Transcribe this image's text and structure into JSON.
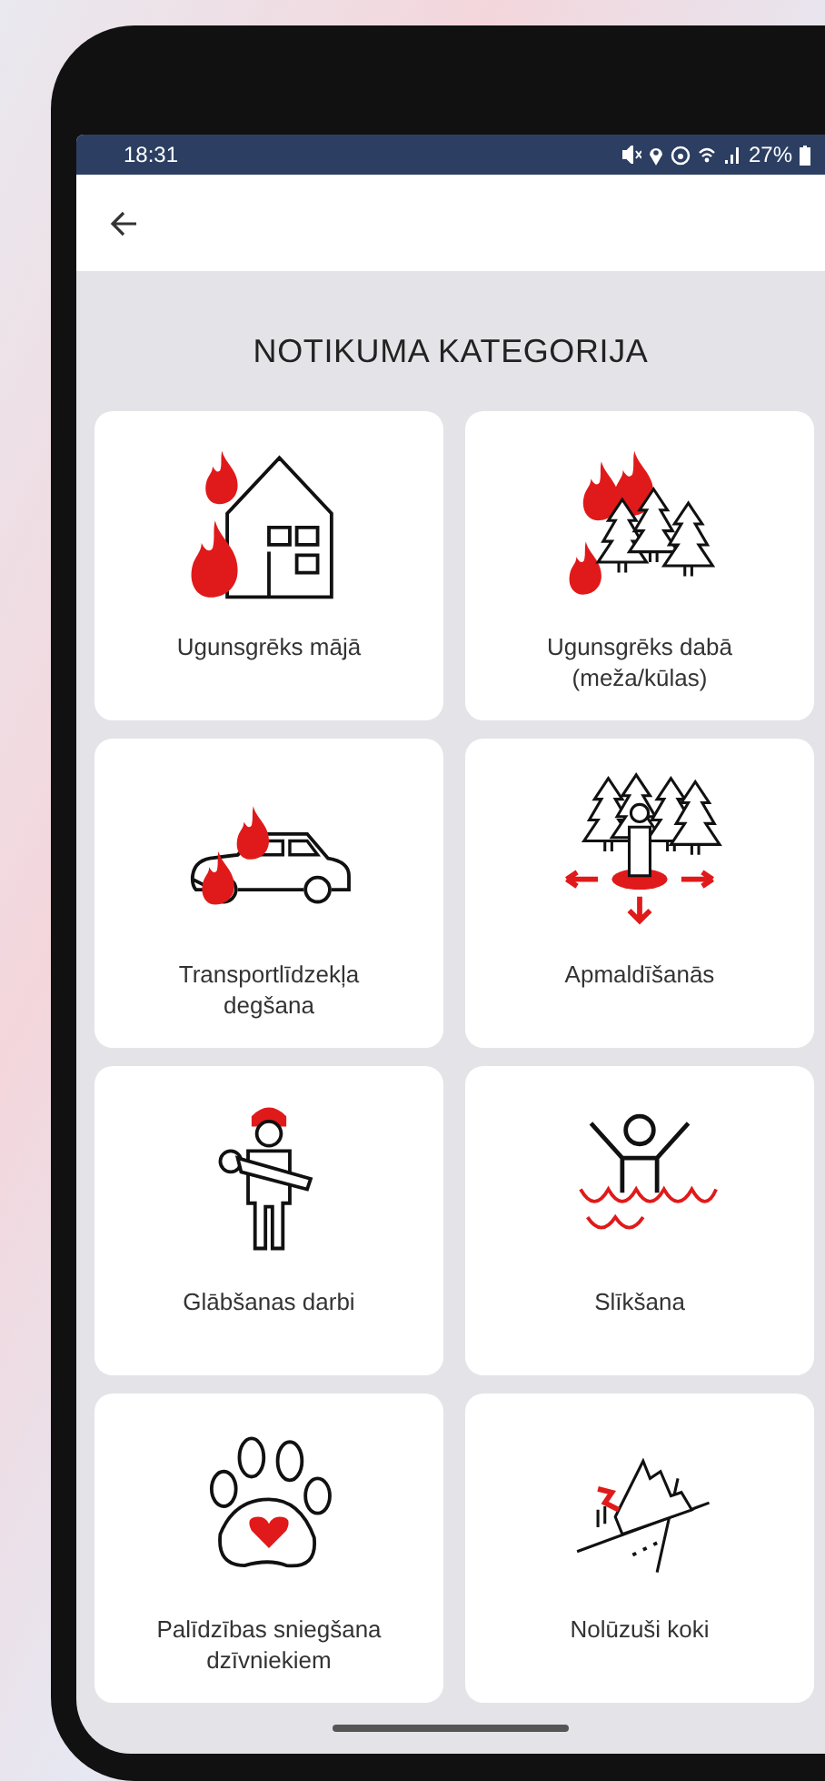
{
  "status_bar": {
    "time": "18:31",
    "battery": "27%"
  },
  "title": "NOTIKUMA KATEGORIJA",
  "categories": [
    {
      "label": "Ugunsgrēks mājā",
      "kind": "house-fire"
    },
    {
      "label": "Ugunsgrēks dabā (meža/kūlas)",
      "kind": "forest-fire"
    },
    {
      "label": "Transportlīdzekļa degšana",
      "kind": "car-fire"
    },
    {
      "label": "Apmaldīšanās",
      "kind": "lost"
    },
    {
      "label": "Glābšanas darbi",
      "kind": "rescue"
    },
    {
      "label": "Slīkšana",
      "kind": "drowning"
    },
    {
      "label": "Palīdzības sniegšana dzīvniekiem",
      "kind": "animal"
    },
    {
      "label": "Nolūzuši koki",
      "kind": "fallen-tree"
    }
  ]
}
